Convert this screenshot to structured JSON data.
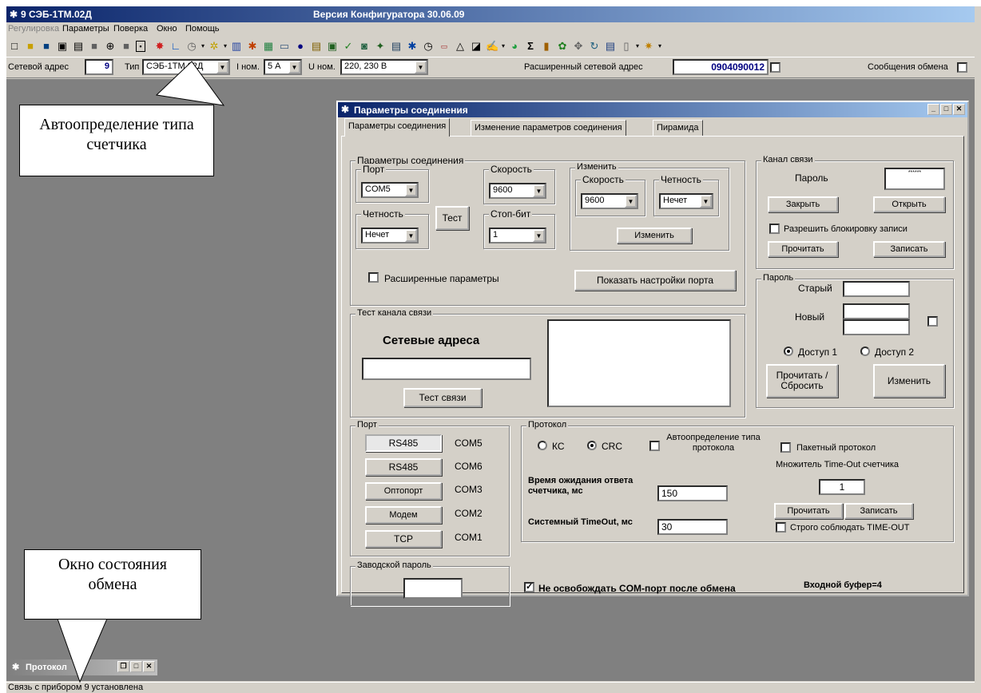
{
  "app": {
    "title": "9 СЭБ-1ТМ.02Д",
    "version": "Версия Конфигуратора 30.06.09"
  },
  "menu": [
    "Регулировка",
    "Параметры",
    "Поверка",
    "Окно",
    "Помощь"
  ],
  "addr": {
    "net_label": "Сетевой адрес",
    "net_value": "9",
    "type_label": "Тип",
    "type_value": "СЭБ-1ТМ.02Д",
    "inom_label": "I ном.",
    "inom_value": "5 А",
    "unom_label": "U ном.",
    "unom_value": "220, 230 В",
    "ext_label": "Расширенный сетевой адрес",
    "ext_value": "0904090012",
    "exchange_label": "Сообщения обмена"
  },
  "dialog": {
    "title": "Параметры соединения",
    "tabs": [
      "Параметры соединения",
      "Изменение параметров соединения",
      "Пирамида"
    ],
    "conn": {
      "title": "Параметры соединения",
      "port_title": "Порт",
      "port_value": "COM5",
      "speed_title": "Скорость",
      "speed_value": "9600",
      "parity_title": "Четность",
      "parity_value": "Нечет",
      "stop_title": "Стоп-бит",
      "stop_value": "1",
      "test_btn": "Тест",
      "change_title": "Изменить",
      "ch_speed_title": "Скорость",
      "ch_speed_value": "9600",
      "ch_parity_title": "Четность",
      "ch_parity_value": "Нечет",
      "change_btn": "Изменить",
      "extended": "Расширенные параметры",
      "show_port_btn": "Показать настройки порта"
    },
    "channel": {
      "title": "Канал связи",
      "password_label": "Пароль",
      "password_value": "******",
      "close_btn": "Закрыть",
      "open_btn": "Открыть",
      "allow_lock": "Разрешить блокировку записи",
      "read_btn": "Прочитать",
      "write_btn": "Записать"
    },
    "password": {
      "title": "Пароль",
      "old_label": "Старый",
      "new_label": "Новый",
      "access1": "Доступ 1",
      "access2": "Доступ 2",
      "read_reset_btn": "Прочитать / Сбросить",
      "change_btn": "Изменить"
    },
    "testchan": {
      "title": "Тест канала связи",
      "net_addresses": "Сетевые адреса",
      "test_btn": "Тест связи"
    },
    "portgrp": {
      "title": "Порт",
      "rows": [
        {
          "btn": "RS485",
          "com": "COM5"
        },
        {
          "btn": "RS485",
          "com": "COM6"
        },
        {
          "btn": "Оптопорт",
          "com": "COM3"
        },
        {
          "btn": "Модем",
          "com": "COM2"
        },
        {
          "btn": "TCP",
          "com": "COM1"
        }
      ]
    },
    "protocol": {
      "title": "Протокол",
      "kc": "КС",
      "crc": "CRC",
      "auto_type": "Автоопределение типа протокола",
      "packet": "Пакетный протокол",
      "multiplier_label": "Множитель Time-Out счетчика",
      "multiplier_value": "1",
      "wait_label": "Время ожидания ответа счетчика, мс",
      "wait_value": "150",
      "sys_label": "Системный TimeOut, мс",
      "sys_value": "30",
      "read_btn": "Прочитать",
      "write_btn": "Записать",
      "strict": "Строго соблюдать TIME-OUT"
    },
    "factory": {
      "title": "Заводской пароль"
    },
    "no_release": "Не освобождать COM-порт после обмена",
    "buffer": "Входной буфер=4"
  },
  "mini_title": "Протокол",
  "status": "Связь с прибором 9 установлена",
  "callouts": {
    "auto": "Автоопределение типа счетчика",
    "window": "Окно состояния обмена"
  }
}
